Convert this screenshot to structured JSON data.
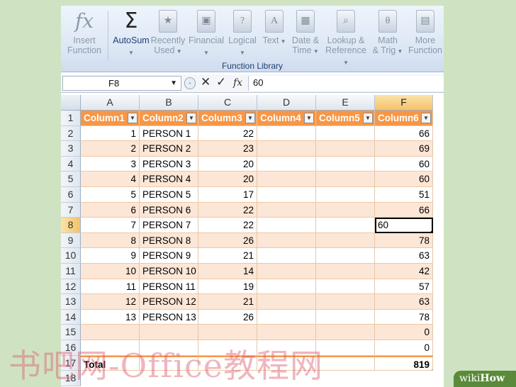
{
  "ribbon": {
    "buttons": [
      {
        "label": "Insert\nFunction",
        "icon": "fx-icon",
        "glyph": "fx"
      },
      {
        "label": "AutoSum",
        "icon": "sigma-icon",
        "glyph": "Σ",
        "dropdown": true
      },
      {
        "label": "Recently\nUsed",
        "icon": "recent-book-icon",
        "glyph": "★",
        "dropdown": true
      },
      {
        "label": "Financial",
        "icon": "financial-book-icon",
        "glyph": "▣",
        "dropdown": true
      },
      {
        "label": "Logical",
        "icon": "logical-book-icon",
        "glyph": "?",
        "dropdown": true
      },
      {
        "label": "Text",
        "icon": "text-book-icon",
        "glyph": "A",
        "dropdown": true
      },
      {
        "label": "Date &\nTime",
        "icon": "datetime-book-icon",
        "glyph": "▦",
        "dropdown": true
      },
      {
        "label": "Lookup &\nReference",
        "icon": "lookup-book-icon",
        "glyph": "⌕",
        "dropdown": true
      },
      {
        "label": "Math\n& Trig",
        "icon": "math-book-icon",
        "glyph": "θ",
        "dropdown": true
      },
      {
        "label": "More\nFunction",
        "icon": "more-book-icon",
        "glyph": "▤",
        "dropdown": false
      }
    ],
    "group_label": "Function Library"
  },
  "formula_bar": {
    "name_box": "F8",
    "cancel_glyph": "✕",
    "enter_glyph": "✓",
    "fx_glyph": "fx",
    "formula": "60"
  },
  "grid": {
    "columns": [
      "A",
      "B",
      "C",
      "D",
      "E",
      "F"
    ],
    "selected_column": "F",
    "selected_row": "8",
    "header_row": {
      "row": "1",
      "cells": [
        "Column1",
        "Column2",
        "Column3",
        "Column4",
        "Column5",
        "Column6"
      ]
    },
    "rows": [
      {
        "row": "2",
        "cells": [
          "1",
          "PERSON 1",
          "22",
          "",
          "",
          "66"
        ]
      },
      {
        "row": "3",
        "cells": [
          "2",
          "PERSON 2",
          "23",
          "",
          "",
          "69"
        ]
      },
      {
        "row": "4",
        "cells": [
          "3",
          "PERSON 3",
          "20",
          "",
          "",
          "60"
        ]
      },
      {
        "row": "5",
        "cells": [
          "4",
          "PERSON 4",
          "20",
          "",
          "",
          "60"
        ]
      },
      {
        "row": "6",
        "cells": [
          "5",
          "PERSON 5",
          "17",
          "",
          "",
          "51"
        ]
      },
      {
        "row": "7",
        "cells": [
          "6",
          "PERSON 6",
          "22",
          "",
          "",
          "66"
        ]
      },
      {
        "row": "8",
        "cells": [
          "7",
          "PERSON 7",
          "22",
          "",
          "",
          "60"
        ]
      },
      {
        "row": "9",
        "cells": [
          "8",
          "PERSON 8",
          "26",
          "",
          "",
          "78"
        ]
      },
      {
        "row": "10",
        "cells": [
          "9",
          "PERSON 9",
          "21",
          "",
          "",
          "63"
        ]
      },
      {
        "row": "11",
        "cells": [
          "10",
          "PERSON 10",
          "14",
          "",
          "",
          "42"
        ]
      },
      {
        "row": "12",
        "cells": [
          "11",
          "PERSON 11",
          "19",
          "",
          "",
          "57"
        ]
      },
      {
        "row": "13",
        "cells": [
          "12",
          "PERSON 12",
          "21",
          "",
          "",
          "63"
        ]
      },
      {
        "row": "14",
        "cells": [
          "13",
          "PERSON 13",
          "26",
          "",
          "",
          "78"
        ]
      },
      {
        "row": "15",
        "cells": [
          "",
          "",
          "",
          "",
          "",
          "0"
        ]
      },
      {
        "row": "16",
        "cells": [
          "",
          "",
          "",
          "",
          "",
          "0"
        ]
      }
    ],
    "total_row": {
      "row": "17",
      "cells": [
        "Total",
        "",
        "",
        "",
        "",
        "819"
      ]
    },
    "partial_row": "18"
  },
  "colors": {
    "table_header": "#f79646",
    "band": "#fce6d6",
    "selection": "#f2c36a"
  },
  "watermark": "书吧网-Office教程网",
  "brand": {
    "prefix": "wiki",
    "suffix": "How"
  }
}
